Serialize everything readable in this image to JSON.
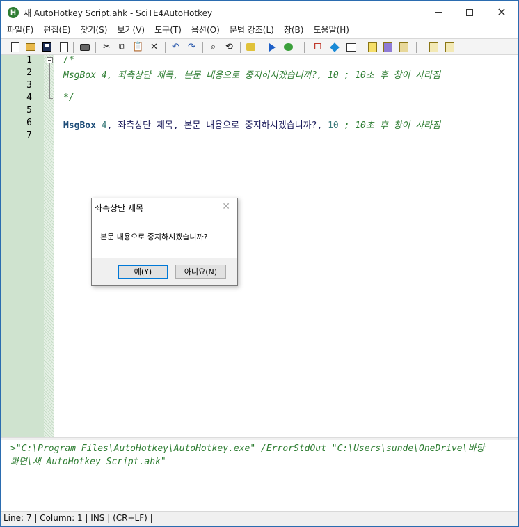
{
  "window": {
    "title": "새 AutoHotkey Script.ahk - SciTE4AutoHotkey",
    "icon_letter": "H"
  },
  "menu": [
    "파일(F)",
    "편집(E)",
    "찾기(S)",
    "보기(V)",
    "도구(T)",
    "옵션(O)",
    "문법 강조(L)",
    "창(B)",
    "도움말(H)"
  ],
  "toolbar_icons": [
    "new-file-icon",
    "open-folder-icon",
    "save-icon",
    "close-file-icon",
    "print-icon",
    "cut-icon",
    "copy-icon",
    "paste-icon",
    "delete-icon",
    "undo-icon",
    "redo-icon",
    "find-icon",
    "replace-icon",
    "compile-icon",
    "run-icon",
    "debug-icon",
    "tool-icon",
    "cube-icon",
    "window-icon",
    "notes-icon",
    "notes2-icon",
    "notes3-icon",
    "script-icon",
    "script2-icon"
  ],
  "editor": {
    "line_numbers": [
      "1",
      "2",
      "3",
      "4",
      "5",
      "6",
      "7"
    ],
    "line1": "/*",
    "line2": "MsgBox 4, 좌측상단 제목, 본문 내용으로 중지하시겠습니까?, 10 ; 10초 후 창이 사라짐",
    "line4": "*/",
    "line6": {
      "keyword": "MsgBox",
      "num1": " 4",
      "text": ", 좌측상단 제목, 본문 내용으로 중지하시겠습니까?, ",
      "num2": "10",
      "comment": " ; 10초 후 창이 사라짐"
    }
  },
  "output": {
    "line1": ">\"C:\\Program Files\\AutoHotkey\\AutoHotkey.exe\" /ErrorStdOut \"C:\\Users\\sunde\\OneDrive\\바탕",
    "line2": "화면\\새 AutoHotkey Script.ahk\""
  },
  "statusbar": "Line: 7 | Column: 1 | INS | (CR+LF) |",
  "msgbox": {
    "title": "좌측상단 제목",
    "body": "본문 내용으로 중지하시겠습니까?",
    "yes_label": "예(Y)",
    "no_label": "아니요(N)"
  }
}
